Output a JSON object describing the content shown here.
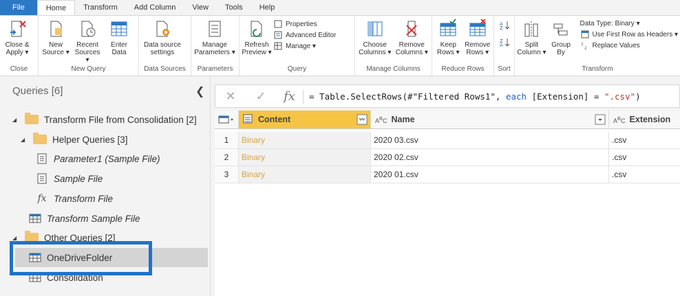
{
  "tabs": [
    "File",
    "Home",
    "Transform",
    "Add Column",
    "View",
    "Tools",
    "Help"
  ],
  "ribbon": {
    "close": {
      "btn1_l1": "Close &",
      "btn1_l2": "Apply ▾",
      "label": "Close"
    },
    "new_query": {
      "new_l1": "New",
      "new_l2": "Source ▾",
      "recent_l1": "Recent",
      "recent_l2": "Sources ▾",
      "enter_l1": "Enter",
      "enter_l2": "Data",
      "label": "New Query"
    },
    "data_sources": {
      "btn_l1": "Data source",
      "btn_l2": "settings",
      "label": "Data Sources"
    },
    "parameters": {
      "btn_l1": "Manage",
      "btn_l2": "Parameters ▾",
      "label": "Parameters"
    },
    "query": {
      "refresh_l1": "Refresh",
      "refresh_l2": "Preview ▾",
      "properties": "Properties",
      "advanced": "Advanced Editor",
      "manage": "Manage ▾",
      "label": "Query"
    },
    "manage_columns": {
      "choose_l1": "Choose",
      "choose_l2": "Columns ▾",
      "remove_l1": "Remove",
      "remove_l2": "Columns ▾",
      "label": "Manage Columns"
    },
    "reduce_rows": {
      "keep_l1": "Keep",
      "keep_l2": "Rows ▾",
      "remove_l1": "Remove",
      "remove_l2": "Rows ▾",
      "label": "Reduce Rows"
    },
    "sort": {
      "label": "Sort"
    },
    "transform": {
      "split_l1": "Split",
      "split_l2": "Column ▾",
      "group_l1": "Group",
      "group_l2": "By",
      "datatype": "Data Type: Binary ▾",
      "first_row": "Use First Row as Headers ▾",
      "replace": "Replace Values",
      "label": "Transform"
    }
  },
  "queries": {
    "title": "Queries [6]",
    "items": [
      {
        "label": "Transform File from Consolidation [2]"
      },
      {
        "label": "Helper Queries [3]"
      },
      {
        "label": "Parameter1 (Sample File)"
      },
      {
        "label": "Sample File"
      },
      {
        "label": "Transform File"
      },
      {
        "label": "Transform Sample File"
      },
      {
        "label": "Other Queries [2]"
      },
      {
        "label": "OneDriveFolder"
      },
      {
        "label": "Consolidation"
      }
    ]
  },
  "formula": {
    "prefix": "= Table.SelectRows(#\"Filtered Rows1\", ",
    "keyword": "each",
    "middle": " [Extension] = ",
    "string": "\".csv\"",
    "suffix": ")"
  },
  "grid": {
    "columns": [
      {
        "name": "Content"
      },
      {
        "name": "Name"
      },
      {
        "name": "Extension"
      }
    ],
    "rows": [
      {
        "n": "1",
        "content": "Binary",
        "name": "2020 03.csv",
        "ext": ".csv"
      },
      {
        "n": "2",
        "content": "Binary",
        "name": "2020 02.csv",
        "ext": ".csv"
      },
      {
        "n": "3",
        "content": "Binary",
        "name": "2020 01.csv",
        "ext": ".csv"
      }
    ]
  },
  "colors": {
    "accent": "#2b78c5",
    "selected_column": "#f6c445",
    "highlight_box": "#1f73c9",
    "folder": "#f2c46b"
  }
}
